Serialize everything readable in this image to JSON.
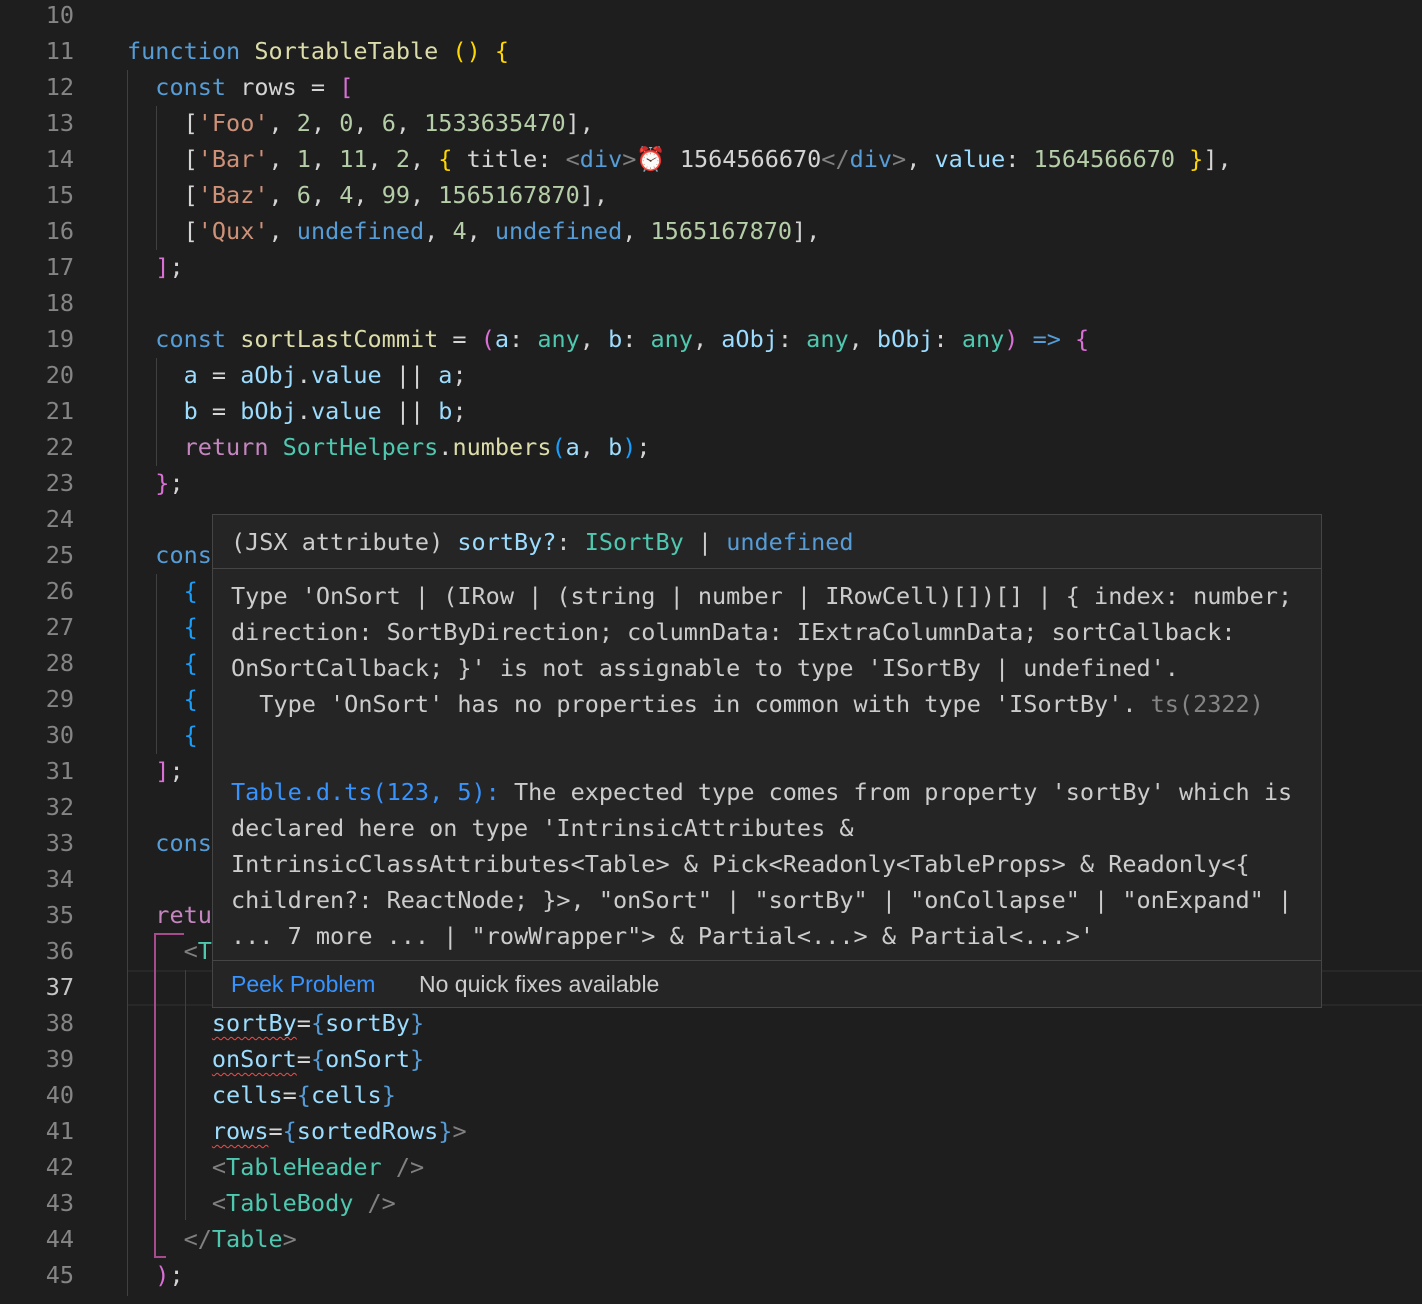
{
  "editor": {
    "line_numbers": [
      "10",
      "11",
      "12",
      "13",
      "14",
      "15",
      "16",
      "17",
      "18",
      "19",
      "20",
      "21",
      "22",
      "23",
      "24",
      "25",
      "26",
      "27",
      "28",
      "29",
      "30",
      "31",
      "32",
      "33",
      "34",
      "35",
      "36",
      "37",
      "38",
      "39",
      "40",
      "41",
      "42",
      "43",
      "44",
      "45"
    ],
    "lines": {
      "l11": [
        [
          "function ",
          "kw"
        ],
        [
          "SortableTable ",
          "fn"
        ],
        [
          "()",
          "b1"
        ],
        [
          " ",
          ""
        ],
        [
          "{",
          "b1"
        ]
      ],
      "l12": [
        [
          "  ",
          ""
        ],
        [
          "const ",
          "kw"
        ],
        [
          "rows",
          ""
        ],
        [
          " = ",
          ""
        ],
        [
          "[",
          "b2"
        ]
      ],
      "l13": [
        [
          "    [",
          ""
        ],
        [
          "'Foo'",
          "str"
        ],
        [
          ", ",
          ""
        ],
        [
          "2",
          "num"
        ],
        [
          ", ",
          ""
        ],
        [
          "0",
          "num"
        ],
        [
          ", ",
          ""
        ],
        [
          "6",
          "num"
        ],
        [
          ", ",
          ""
        ],
        [
          "1533635470",
          "num"
        ],
        [
          "],",
          ""
        ]
      ],
      "l14": [
        [
          "    [",
          ""
        ],
        [
          "'Bar'",
          "str"
        ],
        [
          ", ",
          ""
        ],
        [
          "1",
          "num"
        ],
        [
          ", ",
          ""
        ],
        [
          "11",
          "num"
        ],
        [
          ", ",
          ""
        ],
        [
          "2",
          "num"
        ],
        [
          ", ",
          ""
        ],
        [
          "{ ",
          "b1"
        ],
        [
          "title",
          ""
        ],
        [
          ": ",
          ""
        ],
        [
          "<",
          "punc"
        ],
        [
          "div",
          "kw"
        ],
        [
          ">",
          "punc"
        ],
        [
          "⏰ 1564566670",
          ""
        ],
        [
          "</",
          "punc"
        ],
        [
          "div",
          "kw"
        ],
        [
          ">",
          "punc"
        ],
        [
          ", ",
          ""
        ],
        [
          "value",
          "var"
        ],
        [
          ": ",
          ""
        ],
        [
          "1564566670",
          "num"
        ],
        [
          " }",
          "b1"
        ],
        [
          "],",
          ""
        ]
      ],
      "l15": [
        [
          "    [",
          ""
        ],
        [
          "'Baz'",
          "str"
        ],
        [
          ", ",
          ""
        ],
        [
          "6",
          "num"
        ],
        [
          ", ",
          ""
        ],
        [
          "4",
          "num"
        ],
        [
          ", ",
          ""
        ],
        [
          "99",
          "num"
        ],
        [
          ", ",
          ""
        ],
        [
          "1565167870",
          "num"
        ],
        [
          "],",
          ""
        ]
      ],
      "l16": [
        [
          "    [",
          ""
        ],
        [
          "'Qux'",
          "str"
        ],
        [
          ", ",
          ""
        ],
        [
          "undefined",
          "kw"
        ],
        [
          ", ",
          ""
        ],
        [
          "4",
          "num"
        ],
        [
          ", ",
          ""
        ],
        [
          "undefined",
          "kw"
        ],
        [
          ", ",
          ""
        ],
        [
          "1565167870",
          "num"
        ],
        [
          "],",
          ""
        ]
      ],
      "l17": [
        [
          "  ",
          ""
        ],
        [
          "]",
          "b2"
        ],
        [
          ";",
          ""
        ]
      ],
      "l19": [
        [
          "  ",
          ""
        ],
        [
          "const ",
          "kw"
        ],
        [
          "sortLastCommit",
          "fn"
        ],
        [
          " = ",
          ""
        ],
        [
          "(",
          "b2"
        ],
        [
          "a",
          "var"
        ],
        [
          ": ",
          ""
        ],
        [
          "any",
          "type"
        ],
        [
          ", ",
          ""
        ],
        [
          "b",
          "var"
        ],
        [
          ": ",
          ""
        ],
        [
          "any",
          "type"
        ],
        [
          ", ",
          ""
        ],
        [
          "aObj",
          "var"
        ],
        [
          ": ",
          ""
        ],
        [
          "any",
          "type"
        ],
        [
          ", ",
          ""
        ],
        [
          "bObj",
          "var"
        ],
        [
          ": ",
          ""
        ],
        [
          "any",
          "type"
        ],
        [
          ")",
          "b2"
        ],
        [
          " ",
          ""
        ],
        [
          "=>",
          "kw"
        ],
        [
          " ",
          ""
        ],
        [
          "{",
          "b2"
        ]
      ],
      "l20": [
        [
          "    ",
          ""
        ],
        [
          "a",
          "var"
        ],
        [
          " = ",
          ""
        ],
        [
          "aObj",
          "var"
        ],
        [
          ".",
          ""
        ],
        [
          "value",
          "var"
        ],
        [
          " || ",
          ""
        ],
        [
          "a",
          "var"
        ],
        [
          ";",
          ""
        ]
      ],
      "l21": [
        [
          "    ",
          ""
        ],
        [
          "b",
          "var"
        ],
        [
          " = ",
          ""
        ],
        [
          "bObj",
          "var"
        ],
        [
          ".",
          ""
        ],
        [
          "value",
          "var"
        ],
        [
          " || ",
          ""
        ],
        [
          "b",
          "var"
        ],
        [
          ";",
          ""
        ]
      ],
      "l22": [
        [
          "    ",
          ""
        ],
        [
          "return ",
          "ctrl"
        ],
        [
          "SortHelpers",
          "type"
        ],
        [
          ".",
          ""
        ],
        [
          "numbers",
          "fn"
        ],
        [
          "(",
          "b3"
        ],
        [
          "a",
          "var"
        ],
        [
          ", ",
          ""
        ],
        [
          "b",
          "var"
        ],
        [
          ")",
          "b3"
        ],
        [
          ";",
          ""
        ]
      ],
      "l23": [
        [
          "  ",
          ""
        ],
        [
          "}",
          "b2"
        ],
        [
          ";",
          ""
        ]
      ],
      "l25": [
        [
          "  ",
          ""
        ],
        [
          "cons",
          "kw"
        ]
      ],
      "l26": [
        [
          "    ",
          ""
        ],
        [
          "{",
          "b3"
        ]
      ],
      "l27": [
        [
          "    ",
          ""
        ],
        [
          "{",
          "b3"
        ]
      ],
      "l28": [
        [
          "    ",
          ""
        ],
        [
          "{",
          "b3"
        ]
      ],
      "l29": [
        [
          "    ",
          ""
        ],
        [
          "{",
          "b3"
        ]
      ],
      "l30": [
        [
          "    ",
          ""
        ],
        [
          "{",
          "b3"
        ]
      ],
      "l31": [
        [
          "  ",
          ""
        ],
        [
          "]",
          "b2"
        ],
        [
          ";",
          ""
        ]
      ],
      "l33": [
        [
          "  ",
          ""
        ],
        [
          "cons",
          "kw"
        ]
      ],
      "l35": [
        [
          "  ",
          ""
        ],
        [
          "retu",
          "ctrl"
        ]
      ],
      "l36": [
        [
          "    ",
          ""
        ],
        [
          "<",
          "punc"
        ],
        [
          "T",
          "tag"
        ]
      ],
      "l38": [
        [
          "      ",
          ""
        ],
        [
          "sortBy",
          "attr squig"
        ],
        [
          "=",
          ""
        ],
        [
          "{",
          "kw"
        ],
        [
          "sortBy",
          "var"
        ],
        [
          "}",
          "kw"
        ]
      ],
      "l39": [
        [
          "      ",
          ""
        ],
        [
          "onSort",
          "attr squig"
        ],
        [
          "=",
          ""
        ],
        [
          "{",
          "kw"
        ],
        [
          "onSort",
          "var"
        ],
        [
          "}",
          "kw"
        ]
      ],
      "l40": [
        [
          "      ",
          ""
        ],
        [
          "cells",
          "attr"
        ],
        [
          "=",
          ""
        ],
        [
          "{",
          "kw"
        ],
        [
          "cells",
          "var"
        ],
        [
          "}",
          "kw"
        ]
      ],
      "l41": [
        [
          "      ",
          ""
        ],
        [
          "rows",
          "attr squig"
        ],
        [
          "=",
          ""
        ],
        [
          "{",
          "kw"
        ],
        [
          "sortedRows",
          "var"
        ],
        [
          "}",
          "kw"
        ],
        [
          ">",
          "punc"
        ]
      ],
      "l42": [
        [
          "      ",
          ""
        ],
        [
          "<",
          "punc"
        ],
        [
          "TableHeader",
          "tag"
        ],
        [
          " />",
          "punc"
        ]
      ],
      "l43": [
        [
          "      ",
          ""
        ],
        [
          "<",
          "punc"
        ],
        [
          "TableBody",
          "tag"
        ],
        [
          " />",
          "punc"
        ]
      ],
      "l44": [
        [
          "    ",
          ""
        ],
        [
          "</",
          "punc"
        ],
        [
          "Table",
          "tag"
        ],
        [
          ">",
          "punc"
        ]
      ],
      "l45": [
        [
          "  ",
          ""
        ],
        [
          ")",
          "b2"
        ],
        [
          ";",
          ""
        ]
      ]
    }
  },
  "hover": {
    "sig_prefix": "(JSX attribute) ",
    "sig_name": "sortBy?",
    "sig_colon": ": ",
    "sig_type": "ISortBy",
    "sig_pipe": " | ",
    "sig_undefined": "undefined",
    "error_text": "Type 'OnSort | (IRow | (string | number | IRowCell)[])[] | { index: number; direction: SortByDirection; columnData: IExtraColumnData; sortCallback: OnSortCallback; }' is not assignable to type 'ISortBy | undefined'.",
    "error_sub": "  Type 'OnSort' has no properties in common with type 'ISortBy'. ",
    "error_code": "ts(2322)",
    "related_link": "Table.d.ts(123, 5):",
    "related_text": " The expected type comes from property 'sortBy' which is declared here on type 'IntrinsicAttributes & IntrinsicClassAttributes<Table> & Pick<Readonly<TableProps> & Readonly<{ children?: ReactNode; }>, \"onSort\" | \"sortBy\" | \"onCollapse\" | \"onExpand\" | ... 7 more ... | \"rowWrapper\"> & Partial<...> & Partial<...>'",
    "peek_label": "Peek Problem",
    "nofix_label": "No quick fixes available"
  },
  "colors": {
    "background": "#1e1e1e",
    "hover_bg": "#252526",
    "link": "#3794ff",
    "error_squiggle": "#f14c4c"
  }
}
